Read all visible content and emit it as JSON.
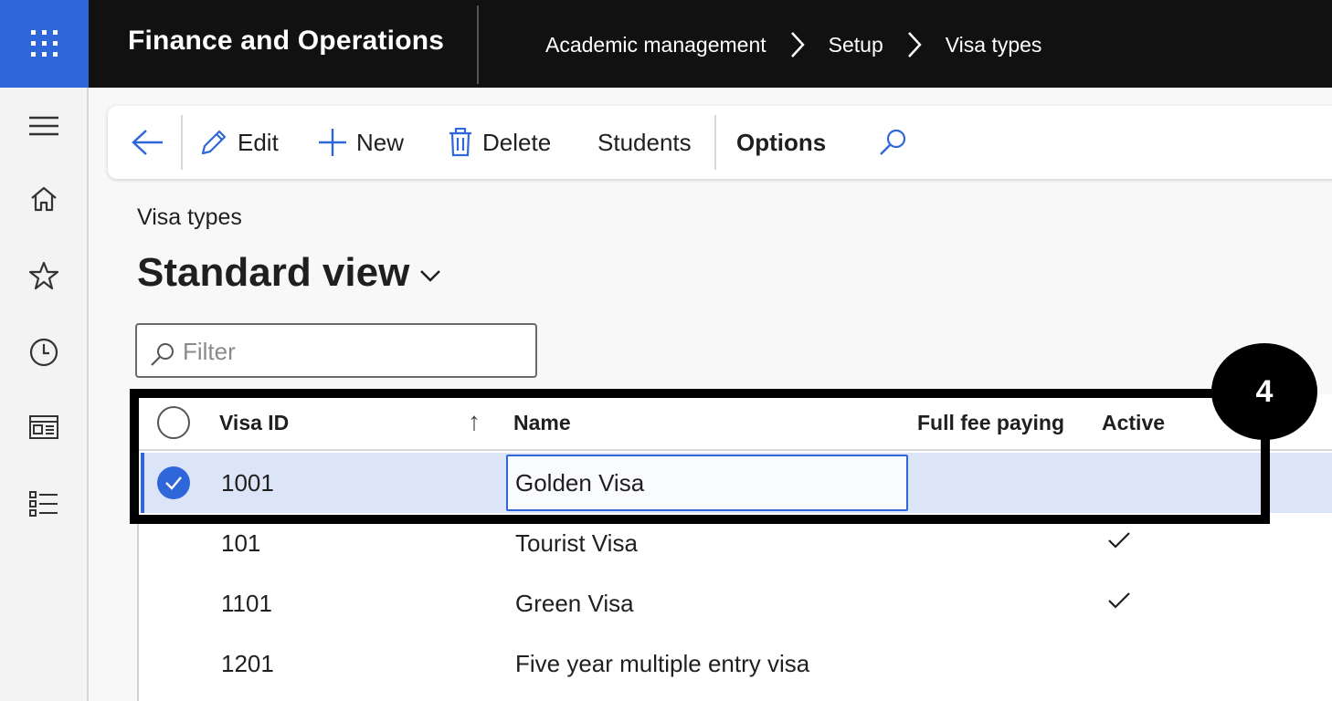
{
  "header": {
    "app_title": "Finance and Operations",
    "breadcrumbs": [
      "Academic management",
      "Setup",
      "Visa types"
    ]
  },
  "toolbar": {
    "edit_label": "Edit",
    "new_label": "New",
    "delete_label": "Delete",
    "students_label": "Students",
    "options_label": "Options"
  },
  "page": {
    "caption": "Visa types",
    "view_title": "Standard view"
  },
  "filter": {
    "placeholder": "Filter"
  },
  "grid": {
    "columns": [
      "Visa ID",
      "Name",
      "Full fee paying",
      "Active"
    ],
    "sort_indicator": "↑",
    "rows": [
      {
        "visa_id": "1001",
        "name": "Golden Visa",
        "full_fee_paying": false,
        "active": false,
        "selected": true
      },
      {
        "visa_id": "101",
        "name": "Tourist Visa",
        "full_fee_paying": false,
        "active": true,
        "selected": false
      },
      {
        "visa_id": "1101",
        "name": "Green Visa",
        "full_fee_paying": false,
        "active": true,
        "selected": false
      },
      {
        "visa_id": "1201",
        "name": "Five year multiple entry visa",
        "full_fee_paying": false,
        "active": false,
        "selected": false
      }
    ]
  },
  "annotation": {
    "step_number": "4"
  },
  "colors": {
    "accent": "#2f66d9",
    "topbar": "#111111",
    "selected_row": "#dce5f7"
  },
  "icons": {
    "waffle": "app-launcher-icon",
    "nav": [
      "hamburger-icon",
      "home-icon",
      "star-icon",
      "clock-icon",
      "workspace-icon",
      "list-icon"
    ]
  }
}
